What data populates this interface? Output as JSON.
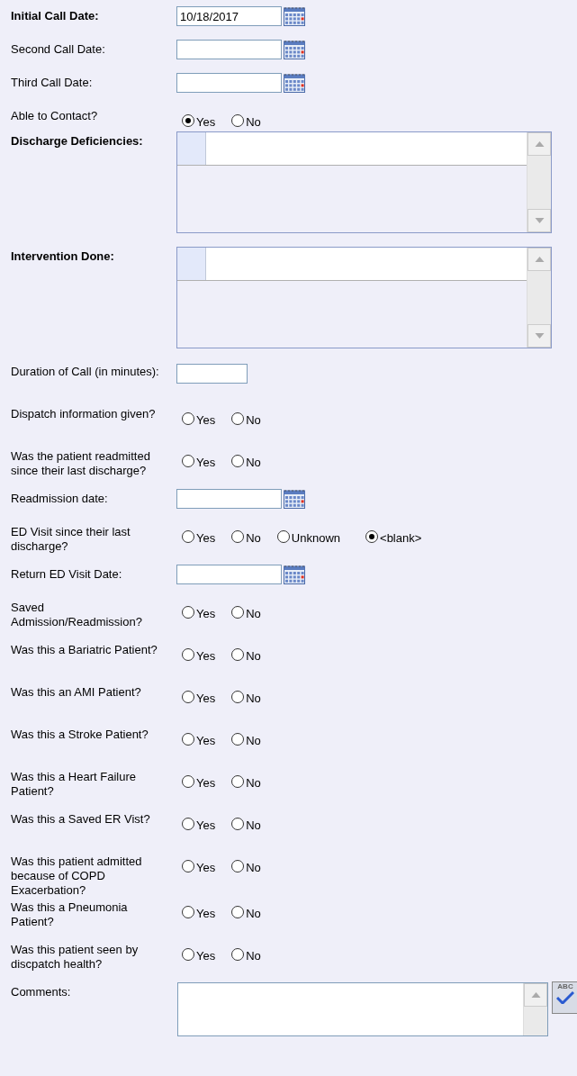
{
  "fields": [
    {
      "kind": "date",
      "label": "Initial Call Date:",
      "required": true,
      "value": "10/18/2017"
    },
    {
      "kind": "date",
      "label": "Second Call Date:",
      "required": false
    },
    {
      "kind": "date",
      "label": "Third Call Date:",
      "required": false
    },
    {
      "kind": "radio",
      "label": "Able to Contact?",
      "required": false,
      "options": [
        {
          "label": "Yes",
          "selected": true
        },
        {
          "label": "No",
          "selected": false
        }
      ]
    },
    {
      "kind": "grid",
      "label": "Discharge Deficiencies:",
      "required": true
    },
    {
      "kind": "grid",
      "label": "Intervention Done:",
      "required": true
    },
    {
      "kind": "number",
      "label": "Duration of Call (in minutes):",
      "required": false
    },
    {
      "kind": "radio",
      "label": "Dispatch information given?",
      "required": false,
      "options": [
        {
          "label": "Yes",
          "selected": false
        },
        {
          "label": "No",
          "selected": false
        }
      ]
    },
    {
      "kind": "radio",
      "label": "Was the patient readmitted since their last discharge?",
      "required": false,
      "options": [
        {
          "label": "Yes",
          "selected": false
        },
        {
          "label": "No",
          "selected": false
        }
      ]
    },
    {
      "kind": "date",
      "label": "Readmission date:",
      "required": false
    },
    {
      "kind": "radio",
      "label": "ED Visit since their last discharge?",
      "required": false,
      "options": [
        {
          "label": "Yes",
          "selected": false
        },
        {
          "label": "No",
          "selected": false
        },
        {
          "label": "Unknown",
          "selected": false
        },
        {
          "label": "<blank>",
          "selected": true
        }
      ]
    },
    {
      "kind": "date",
      "label": "Return ED Visit Date:",
      "required": false
    },
    {
      "kind": "radio",
      "label": "Saved Admission/Readmission?",
      "required": false,
      "options": [
        {
          "label": "Yes",
          "selected": false
        },
        {
          "label": "No",
          "selected": false
        }
      ]
    },
    {
      "kind": "radio",
      "label": "Was this a Bariatric Patient?",
      "required": false,
      "options": [
        {
          "label": "Yes",
          "selected": false
        },
        {
          "label": "No",
          "selected": false
        }
      ]
    },
    {
      "kind": "radio",
      "label": "Was this an AMI Patient?",
      "required": false,
      "options": [
        {
          "label": "Yes",
          "selected": false
        },
        {
          "label": "No",
          "selected": false
        }
      ]
    },
    {
      "kind": "radio",
      "label": "Was this a Stroke Patient?",
      "required": false,
      "options": [
        {
          "label": "Yes",
          "selected": false
        },
        {
          "label": "No",
          "selected": false
        }
      ]
    },
    {
      "kind": "radio",
      "label": "Was this a Heart Failure Patient?",
      "required": false,
      "options": [
        {
          "label": "Yes",
          "selected": false
        },
        {
          "label": "No",
          "selected": false
        }
      ]
    },
    {
      "kind": "radio",
      "label": "Was this a Saved ER Vist?",
      "required": false,
      "options": [
        {
          "label": "Yes",
          "selected": false
        },
        {
          "label": "No",
          "selected": false
        }
      ]
    },
    {
      "kind": "radio",
      "label": "Was this patient admitted because of COPD Exacerbation?",
      "required": false,
      "options": [
        {
          "label": "Yes",
          "selected": false
        },
        {
          "label": "No",
          "selected": false
        }
      ]
    },
    {
      "kind": "radio",
      "label": "Was this a Pneumonia Patient?",
      "required": false,
      "options": [
        {
          "label": "Yes",
          "selected": false
        },
        {
          "label": "No",
          "selected": false
        }
      ]
    },
    {
      "kind": "radio",
      "label": "Was this patient seen by discpatch health?",
      "required": false,
      "options": [
        {
          "label": "Yes",
          "selected": false
        },
        {
          "label": "No",
          "selected": false
        }
      ]
    },
    {
      "kind": "textarea",
      "label": "Comments:",
      "required": false,
      "spellcheck_label": "ABC"
    }
  ]
}
